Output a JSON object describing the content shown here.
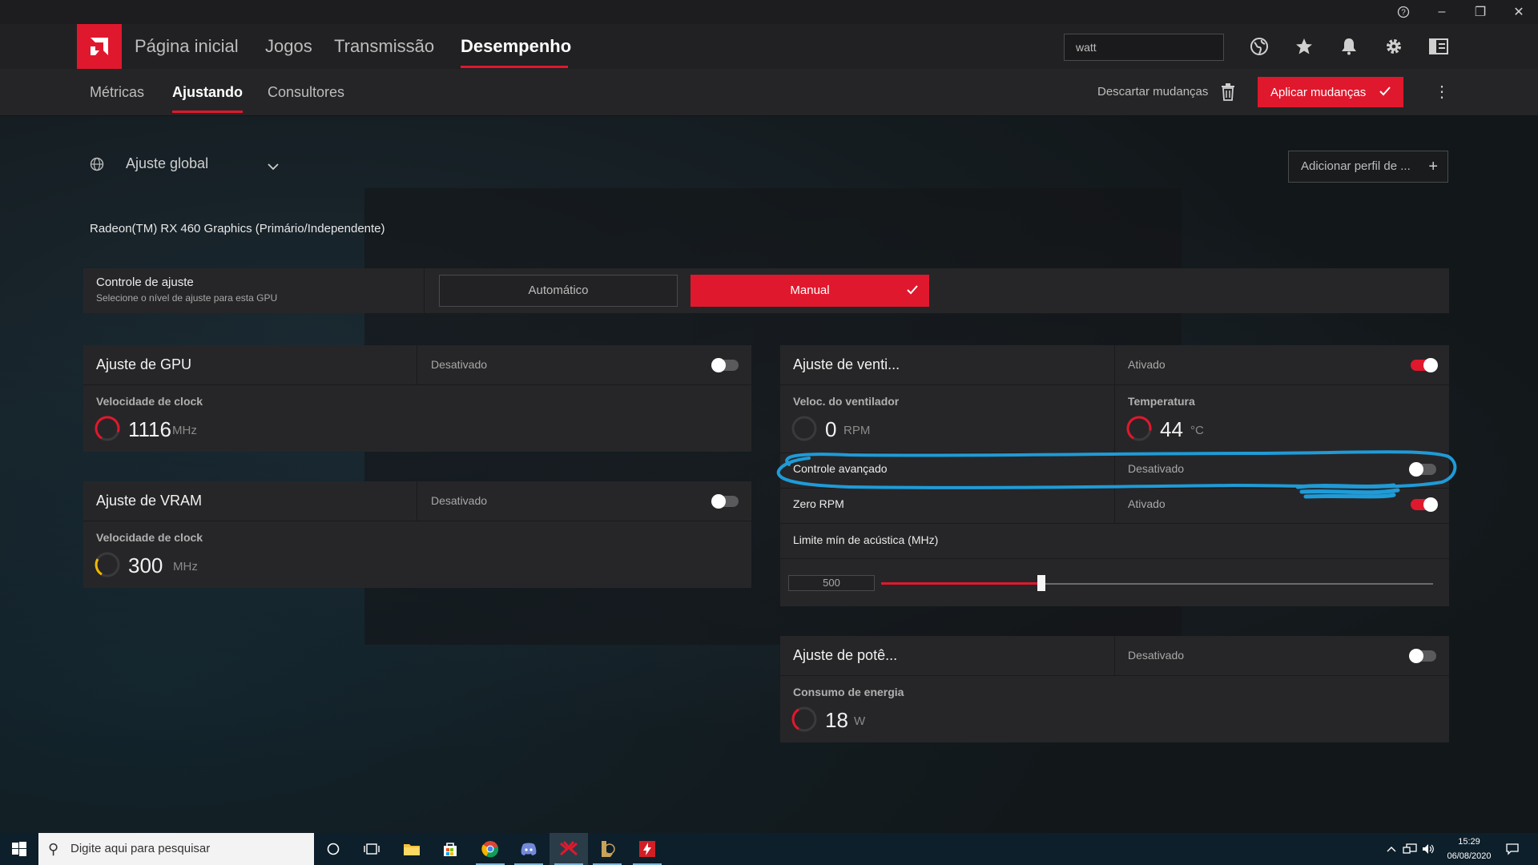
{
  "window": {
    "help_icon": "?",
    "minimize": "–",
    "restore": "❐",
    "close": "✕"
  },
  "nav": {
    "items": [
      "Página inicial",
      "Jogos",
      "Transmissão",
      "Desempenho"
    ],
    "search_value": "watt"
  },
  "subnav": {
    "items": [
      "Métricas",
      "Ajustando",
      "Consultores"
    ],
    "discard": "Descartar mudanças",
    "apply": "Aplicar mudanças"
  },
  "global": {
    "label": "Ajuste global",
    "add_profile": "Adicionar perfil de ..."
  },
  "gpu_name": "Radeon(TM) RX 460 Graphics (Primário/Independente)",
  "tuning_control": {
    "title": "Controle de ajuste",
    "subtitle": "Selecione o nível de ajuste para esta GPU",
    "auto": "Automático",
    "manual": "Manual"
  },
  "gpu_card": {
    "title": "Ajuste de GPU",
    "state": "Desativado",
    "metric_label": "Velocidade de clock",
    "value": "1116",
    "unit": "MHz"
  },
  "vram_card": {
    "title": "Ajuste de VRAM",
    "state": "Desativado",
    "metric_label": "Velocidade de clock",
    "value": "300",
    "unit": "MHz"
  },
  "fan_card": {
    "title": "Ajuste de venti...",
    "state": "Ativado",
    "fan_label": "Veloc. do ventilador",
    "fan_value": "0",
    "fan_unit": "RPM",
    "temp_label": "Temperatura",
    "temp_value": "44",
    "temp_unit": "°C",
    "advanced_label": "Controle avançado",
    "advanced_state": "Desativado",
    "zero_rpm_label": "Zero RPM",
    "zero_rpm_state": "Ativado",
    "acoustic_label": "Limite mín de acústica (MHz)",
    "acoustic_value": "500",
    "acoustic_fraction": 0.29
  },
  "power_card": {
    "title": "Ajuste de potê...",
    "state": "Desativado",
    "metric_label": "Consumo de energia",
    "value": "18",
    "unit": "W"
  },
  "taskbar": {
    "search_placeholder": "Digite aqui para pesquisar",
    "time": "15:29",
    "date": "06/08/2020"
  },
  "colors": {
    "accent": "#e0182d",
    "annotation": "#1f9bd7"
  }
}
